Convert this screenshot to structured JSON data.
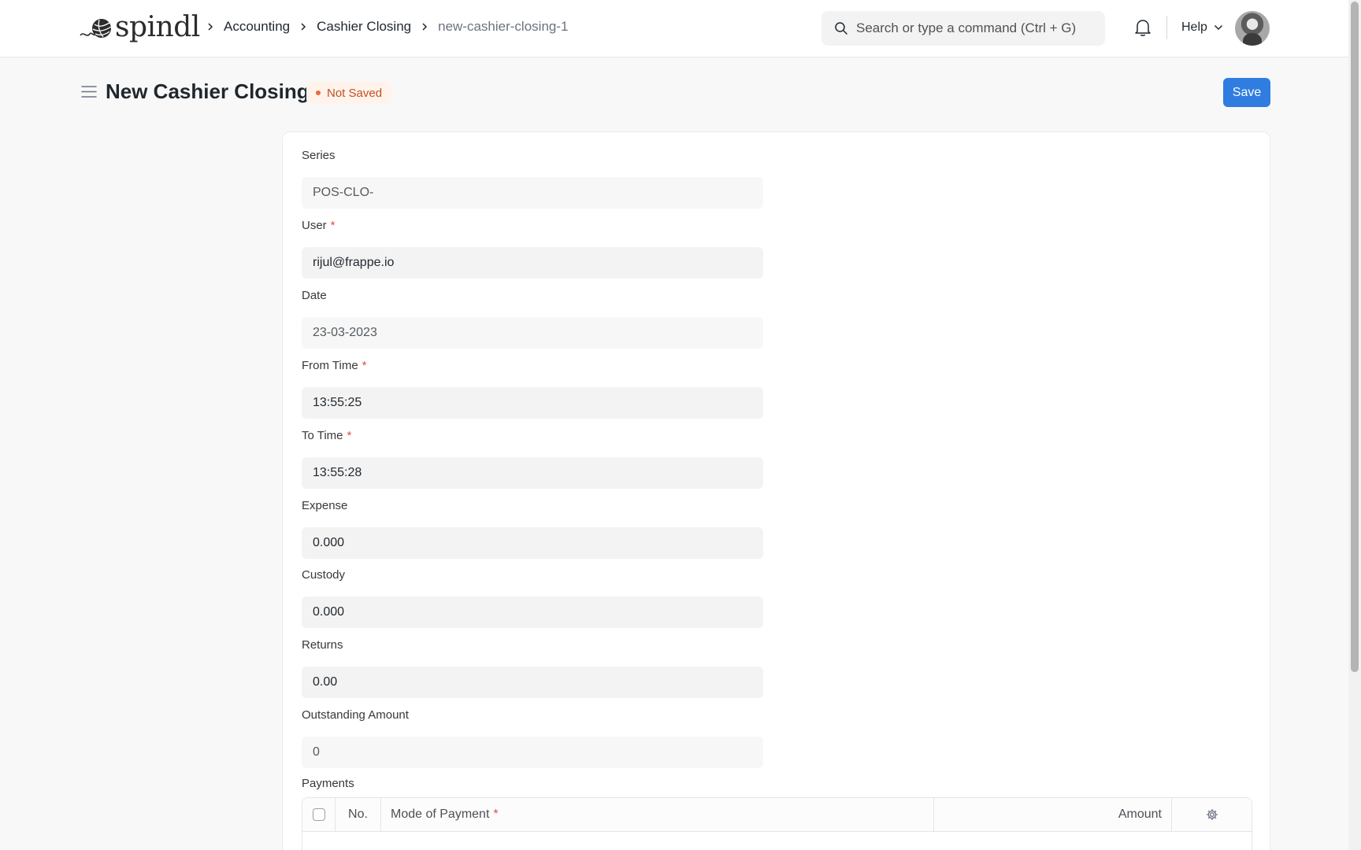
{
  "app": {
    "logo_text": "spindl"
  },
  "breadcrumbs": [
    "Accounting",
    "Cashier Closing"
  ],
  "breadcrumb_current": "new-cashier-closing-1",
  "search": {
    "placeholder": "Search or type a command (Ctrl + G)"
  },
  "nav": {
    "help_label": "Help"
  },
  "page": {
    "title": "New Cashier Closing",
    "status": "Not Saved",
    "save_label": "Save"
  },
  "form": {
    "series": {
      "label": "Series",
      "value": "POS-CLO-"
    },
    "user": {
      "label": "User",
      "value": "rijul@frappe.io"
    },
    "date": {
      "label": "Date",
      "value": "23-03-2023"
    },
    "from_time": {
      "label": "From Time",
      "value": "13:55:25"
    },
    "to_time": {
      "label": "To Time",
      "value": "13:55:28"
    },
    "expense": {
      "label": "Expense",
      "value": "0.000"
    },
    "custody": {
      "label": "Custody",
      "value": "0.000"
    },
    "returns": {
      "label": "Returns",
      "value": "0.00"
    },
    "outstanding": {
      "label": "Outstanding Amount",
      "value": "0"
    },
    "required_mark": "*"
  },
  "payments": {
    "label": "Payments",
    "columns": {
      "no": "No.",
      "mode": "Mode of Payment",
      "amount": "Amount"
    }
  },
  "icons": {
    "logo": "yarn-ball-icon",
    "breadcrumb_separator": "chevron-right-icon",
    "search": "search-icon",
    "notifications": "bell-icon",
    "help_dropdown": "chevron-down-icon",
    "sidebar_toggle": "menu-icon",
    "grid_settings": "gear-icon"
  },
  "colors": {
    "primary": "#2f7de1",
    "status_text": "#c2501f",
    "status_bg": "#fff3ec",
    "required": "#e24c4c"
  }
}
